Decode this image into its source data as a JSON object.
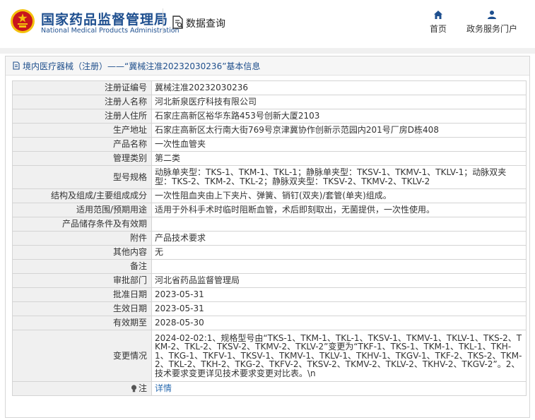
{
  "header": {
    "logo_cn": "国家药品监督管理局",
    "logo_en": "National Medical Products Administration",
    "data_query": "数据查询",
    "nav": {
      "home": "首页",
      "services": "政务服务门户"
    }
  },
  "panel": {
    "title": "境内医疗器械（注册）——“冀械注准20232030236”基本信息"
  },
  "rows": [
    {
      "label": "注册证编号",
      "value": "冀械注准20232030236"
    },
    {
      "label": "注册人名称",
      "value": "河北新泉医疗科技有限公司"
    },
    {
      "label": "注册人住所",
      "value": "石家庄高新区裕华东路453号创新大厦2103"
    },
    {
      "label": "生产地址",
      "value": "石家庄高新区太行南大街769号京津冀协作创新示范园内201号厂房D栋408"
    },
    {
      "label": "产品名称",
      "value": "一次性血管夹"
    },
    {
      "label": "管理类别",
      "value": "第二类"
    },
    {
      "label": "型号规格",
      "value": "动脉单夹型：TKS-1、TKM-1、TKL-1；静脉单夹型：TKSV-1、TKMV-1、TKLV-1；动脉双夹型：TKS-2、TKM-2、TKL-2；静脉双夹型：TKSV-2、TKMV-2、TKLV-2"
    },
    {
      "label": "结构及组成/主要组成成分",
      "value": "一次性阻血夹由上下夹片、弹簧、销钉(双夹)/套管(单夹)组成。"
    },
    {
      "label": "适用范围/预期用途",
      "value": "适用于外科手术时临时阻断血管，术后即刻取出，无菌提供，一次性使用。"
    },
    {
      "label": "产品储存条件及有效期",
      "value": ""
    },
    {
      "label": "附件",
      "value": "产品技术要求"
    },
    {
      "label": "其他内容",
      "value": "无"
    },
    {
      "label": "备注",
      "value": ""
    },
    {
      "label": "审批部门",
      "value": "河北省药品监督管理局"
    },
    {
      "label": "批准日期",
      "value": "2023-05-31"
    },
    {
      "label": "生效日期",
      "value": "2023-05-31"
    },
    {
      "label": "有效期至",
      "value": "2028-05-30"
    },
    {
      "label": "变更情况",
      "value": "2024-02-02:1、规格型号由“TKS-1、TKM-1、TKL-1、TKSV-1、TKMV-1、TKLV-1、TKS-2、TKM-2、TKL-2、TKSV-2、TKMV-2、TKLV-2”变更为“TKF-1、TKS-1、TKM-1、TKL-1、TKH-1、TKG-1、TKFV-1、TKSV-1、TKMV-1、TKLV-1、TKHV-1、TKGV-1、TKF-2、TKS-2、TKM-2、TKL-2、TKH-2、TKG-2、TKFV-2、TKSV-2、TKMV-2、TKLV-2、TKHV-2、TKGV-2”。2、技术要求变更详见技术要求变更对比表。\\n"
    }
  ],
  "note_row": {
    "label": "注",
    "link": "详情"
  },
  "icons": {
    "emblem": "national-emblem-icon",
    "data_query": "document-search-icon",
    "home": "home-icon",
    "services": "user-icon",
    "panel_title": "document-icon",
    "note": "lightbulb-icon"
  },
  "colors": {
    "brand": "#1e4f8f",
    "link": "#2b6cb0",
    "label_bg": "#f0f0f0",
    "emblem_red": "#c8161d",
    "emblem_gold": "#f4c20d"
  }
}
